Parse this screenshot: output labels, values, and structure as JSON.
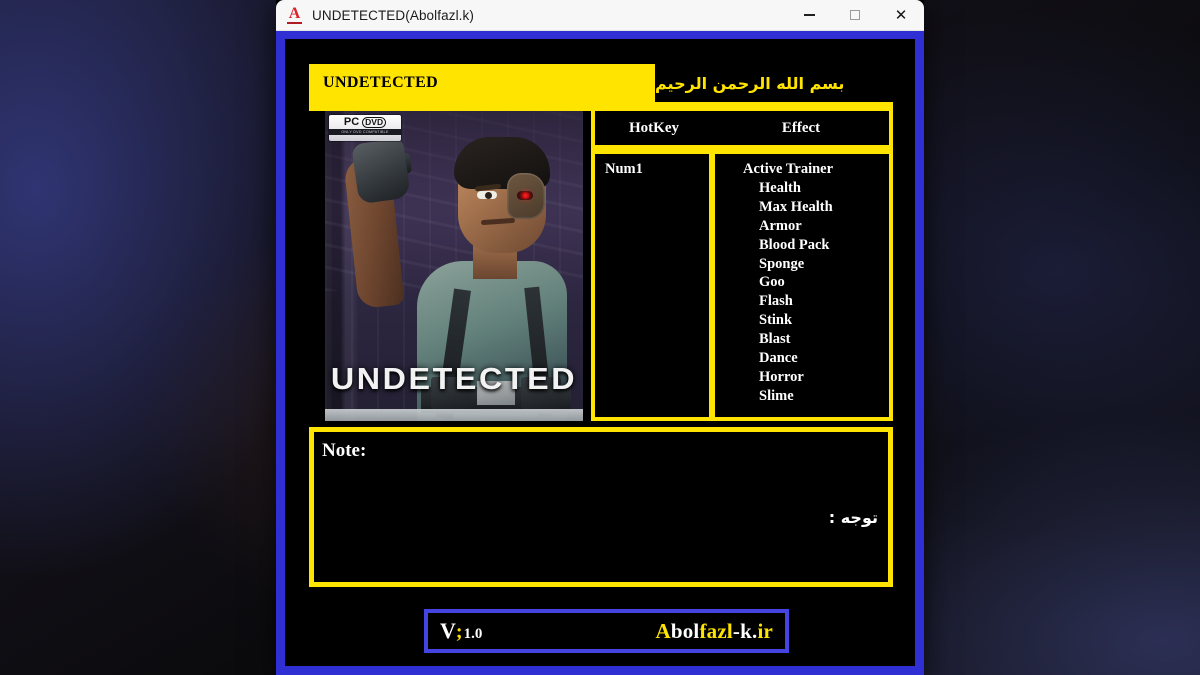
{
  "window": {
    "title": "UNDETECTED(Abolfazl.k)",
    "icon": "app-a-icon",
    "controls": {
      "minimize": "minimize",
      "maximize": "maximize",
      "close": "close"
    }
  },
  "header": {
    "left_label": "UNDETECTED",
    "bismillah": "بسم الله الرحمن الرحيم"
  },
  "cover": {
    "badge_pc": "PC",
    "badge_dvd": "DVD",
    "badge_note": "ONLY DVD COMPATIBLE",
    "wordmark": "UNDETECTED"
  },
  "table": {
    "col_hotkey": "HotKey",
    "col_effect": "Effect",
    "hotkeys": [
      "Num1"
    ],
    "effects": [
      "Active Trainer",
      "Health",
      "Max Health",
      "Armor",
      "Blood Pack",
      "Sponge",
      "Goo",
      "Flash",
      "Stink",
      "Blast",
      "Dance",
      "Horror",
      "Slime"
    ]
  },
  "note": {
    "label": "Note:",
    "label_fa": "توجه :"
  },
  "footer": {
    "version_v": "V",
    "version_sep": ";",
    "version_num": "1.0",
    "brand_parts": [
      {
        "text": "A",
        "color": "#ffe400"
      },
      {
        "text": "bol",
        "color": "#ffffff"
      },
      {
        "text": "fazl",
        "color": "#ffe400"
      },
      {
        "text": "-k.",
        "color": "#ffffff"
      },
      {
        "text": "ir",
        "color": "#ffe400"
      }
    ]
  },
  "colors": {
    "accent_yellow": "#ffe400",
    "frame_blue": "#2f2fd4",
    "footer_blue": "#4444e0",
    "background_black": "#000000",
    "icon_red": "#d8232a"
  }
}
